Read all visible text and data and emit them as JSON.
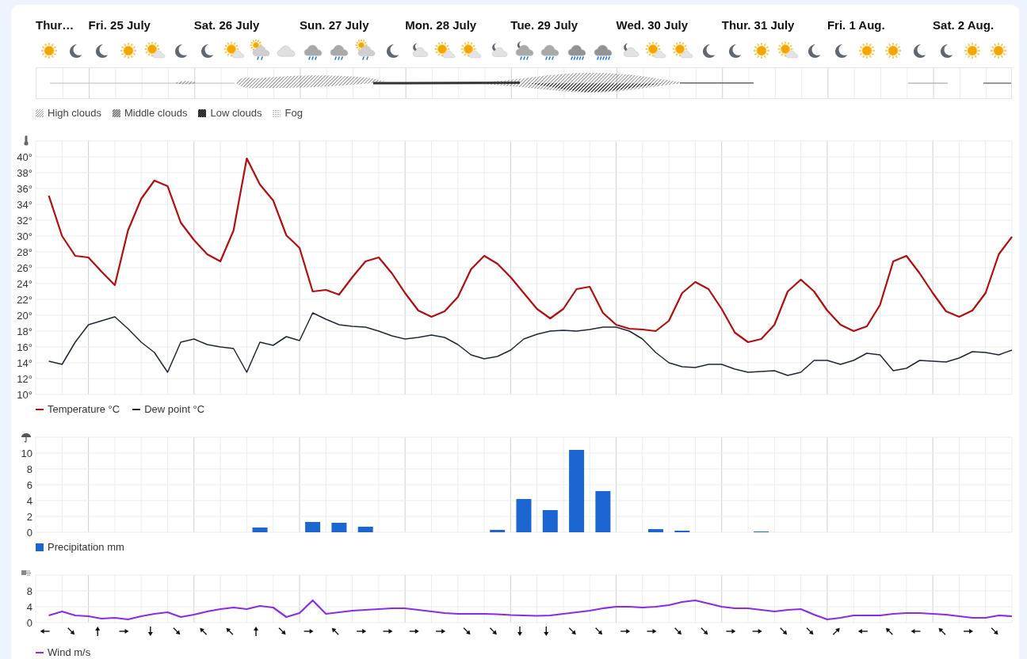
{
  "days": [
    "Thur…",
    "Fri. 25 July",
    "Sat. 26 July",
    "Sun. 27 July",
    "Mon. 28 July",
    "Tue. 29 July",
    "Wed. 30 July",
    "Thur. 31 July",
    "Fri. 1 Aug.",
    "Sat. 2 Aug."
  ],
  "forecast_icons": [
    {
      "kind": "sun"
    },
    {
      "kind": "moon"
    },
    {
      "kind": "moon"
    },
    {
      "kind": "sun"
    },
    {
      "kind": "partly-sunny"
    },
    {
      "kind": "moon"
    },
    {
      "kind": "moon"
    },
    {
      "kind": "partly-sunny"
    },
    {
      "kind": "sun-shower"
    },
    {
      "kind": "cloudy"
    },
    {
      "kind": "rain"
    },
    {
      "kind": "rain"
    },
    {
      "kind": "sun-shower"
    },
    {
      "kind": "moon"
    },
    {
      "kind": "partly-night"
    },
    {
      "kind": "partly-sunny"
    },
    {
      "kind": "partly-sunny"
    },
    {
      "kind": "partly-night"
    },
    {
      "kind": "night-rain"
    },
    {
      "kind": "rain"
    },
    {
      "kind": "heavy-rain"
    },
    {
      "kind": "heavy-rain"
    },
    {
      "kind": "partly-night"
    },
    {
      "kind": "partly-sunny"
    },
    {
      "kind": "partly-sunny"
    },
    {
      "kind": "moon"
    },
    {
      "kind": "moon"
    },
    {
      "kind": "sun"
    },
    {
      "kind": "partly-sunny"
    },
    {
      "kind": "moon"
    },
    {
      "kind": "moon"
    },
    {
      "kind": "sun"
    },
    {
      "kind": "sun"
    },
    {
      "kind": "moon"
    },
    {
      "kind": "moon"
    },
    {
      "kind": "sun"
    },
    {
      "kind": "sun"
    }
  ],
  "cloud_legend": [
    {
      "label": "High clouds",
      "kind": "high"
    },
    {
      "label": "Middle clouds",
      "kind": "middle"
    },
    {
      "label": "Low clouds",
      "kind": "low"
    },
    {
      "label": "Fog",
      "kind": "fog"
    }
  ],
  "temperature": {
    "chart_data": {
      "type": "line",
      "grid": true,
      "categories": [
        null,
        null,
        null,
        null,
        null,
        null,
        null,
        null,
        null,
        null,
        null,
        null,
        null,
        null,
        null,
        null,
        null,
        null,
        null,
        null,
        null,
        null,
        null,
        null,
        null,
        null,
        null,
        null,
        null,
        null,
        null,
        null,
        null,
        null,
        null,
        null,
        null,
        null,
        null,
        null,
        null,
        null,
        null,
        null,
        null,
        null,
        null,
        null,
        null,
        null,
        null,
        null,
        null,
        null,
        null,
        null,
        null,
        null,
        null,
        null,
        null,
        null,
        null,
        null,
        null,
        null,
        null,
        null,
        null,
        null,
        null,
        null,
        null,
        null
      ],
      "ylim": [
        10,
        42
      ],
      "yticks": [
        {
          "value": 10,
          "label": "10°"
        },
        {
          "value": 12,
          "label": "12°"
        },
        {
          "value": 14,
          "label": "14°"
        },
        {
          "value": 16,
          "label": "16°"
        },
        {
          "value": 18,
          "label": "18°"
        },
        {
          "value": 20,
          "label": "20°"
        },
        {
          "value": 22,
          "label": "22°"
        },
        {
          "value": 24,
          "label": "24°"
        },
        {
          "value": 26,
          "label": "26°"
        },
        {
          "value": 28,
          "label": "28°"
        },
        {
          "value": 30,
          "label": "30°"
        },
        {
          "value": 32,
          "label": "32°"
        },
        {
          "value": 34,
          "label": "34°"
        },
        {
          "value": 36,
          "label": "36°"
        },
        {
          "value": 38,
          "label": "38°"
        },
        {
          "value": 40,
          "label": "40°"
        }
      ],
      "series": [
        {
          "name": "Temperature °C",
          "color": "#b40d0d",
          "values": [
            35.1,
            30.0,
            27.5,
            27.3,
            25.5,
            23.8,
            30.7,
            34.7,
            37.0,
            36.3,
            31.7,
            29.5,
            27.7,
            26.8,
            30.7,
            39.8,
            36.5,
            34.5,
            30.1,
            28.5,
            23.0,
            23.2,
            22.6,
            24.8,
            26.8,
            27.3,
            25.3,
            22.8,
            20.6,
            19.8,
            20.5,
            22.3,
            25.8,
            27.5,
            26.5,
            24.8,
            22.8,
            20.8,
            19.6,
            20.8,
            23.3,
            23.6,
            20.3,
            18.8,
            18.3,
            18.2,
            18.0,
            19.3,
            22.8,
            24.2,
            23.3,
            20.8,
            17.8,
            16.6,
            17.0,
            18.8,
            23.0,
            24.5,
            23.0,
            20.6,
            18.8,
            18.0,
            18.6,
            21.3,
            26.8,
            27.5,
            25.3,
            22.8,
            20.5,
            19.8,
            20.6,
            22.8,
            27.7,
            29.9
          ]
        },
        {
          "name": "Dew point °C",
          "color": "#1e2833",
          "values": [
            14.2,
            13.8,
            16.6,
            18.8,
            19.3,
            19.8,
            18.3,
            16.6,
            15.3,
            12.8,
            16.6,
            17.0,
            16.3,
            16.0,
            15.8,
            12.8,
            16.6,
            16.2,
            17.3,
            16.8,
            20.3,
            19.5,
            18.8,
            18.6,
            18.5,
            18.0,
            17.4,
            17.0,
            17.2,
            17.5,
            17.2,
            16.3,
            15.0,
            14.5,
            14.8,
            15.6,
            17.0,
            17.6,
            18.0,
            18.1,
            18.0,
            18.2,
            18.5,
            18.5,
            18.0,
            17.0,
            15.3,
            14.0,
            13.5,
            13.4,
            13.8,
            13.8,
            13.2,
            12.8,
            12.9,
            13.0,
            12.4,
            12.8,
            14.3,
            14.3,
            13.8,
            14.3,
            15.2,
            15.0,
            13.0,
            13.3,
            14.3,
            14.2,
            14.1,
            14.6,
            15.4,
            15.3,
            15.0,
            15.6
          ]
        }
      ]
    }
  },
  "precipitation": {
    "chart_data": {
      "type": "bar",
      "grid": true,
      "categories": [
        null,
        null,
        null,
        null,
        null,
        null,
        null,
        null,
        null,
        null,
        null,
        null,
        null,
        null,
        null,
        null,
        null,
        null,
        null,
        null,
        null,
        null,
        null,
        null,
        null,
        null,
        null,
        null,
        null,
        null,
        null,
        null,
        null,
        null,
        null,
        null,
        null
      ],
      "ylim": [
        0,
        12
      ],
      "yticks": [
        {
          "value": 0,
          "label": "0"
        },
        {
          "value": 2,
          "label": "2"
        },
        {
          "value": 4,
          "label": "4"
        },
        {
          "value": 6,
          "label": "6"
        },
        {
          "value": 8,
          "label": "8"
        },
        {
          "value": 10,
          "label": "10"
        }
      ],
      "series": [
        {
          "name": "Precipitation mm",
          "color": "#1b66d0",
          "values": [
            0,
            0,
            0,
            0,
            0,
            0,
            0,
            0,
            0.6,
            0,
            1.3,
            1.2,
            0.7,
            0,
            0,
            0,
            0,
            0.3,
            4.2,
            2.8,
            10.4,
            5.2,
            0,
            0.4,
            0.2,
            0,
            0,
            0.1,
            0,
            0,
            0,
            0,
            0,
            0,
            0,
            0,
            0
          ]
        }
      ]
    }
  },
  "wind": {
    "chart_data": {
      "type": "line",
      "grid": true,
      "categories": [
        null,
        null,
        null,
        null,
        null,
        null,
        null,
        null,
        null,
        null,
        null,
        null,
        null,
        null,
        null,
        null,
        null,
        null,
        null,
        null,
        null,
        null,
        null,
        null,
        null,
        null,
        null,
        null,
        null,
        null,
        null,
        null,
        null,
        null,
        null,
        null,
        null,
        null,
        null,
        null,
        null,
        null,
        null,
        null,
        null,
        null,
        null,
        null,
        null,
        null,
        null,
        null,
        null,
        null,
        null,
        null,
        null,
        null,
        null,
        null,
        null,
        null,
        null,
        null,
        null,
        null,
        null,
        null,
        null,
        null,
        null,
        null,
        null,
        null
      ],
      "ylim": [
        0,
        12
      ],
      "yticks": [
        {
          "value": 0,
          "label": "0"
        },
        {
          "value": 4,
          "label": "4"
        },
        {
          "value": 8,
          "label": "8"
        }
      ],
      "series": [
        {
          "name": "Wind m/s",
          "color": "#8a2be8",
          "values": [
            1.8,
            2.8,
            1.8,
            1.6,
            1.0,
            1.2,
            0.8,
            1.6,
            2.2,
            2.6,
            1.4,
            2.0,
            2.8,
            3.4,
            3.8,
            3.4,
            4.2,
            3.8,
            1.4,
            2.4,
            5.6,
            2.2,
            2.6,
            3.0,
            3.2,
            3.4,
            3.6,
            3.6,
            3.2,
            2.8,
            2.4,
            2.2,
            2.2,
            2.2,
            2.1,
            1.9,
            1.8,
            1.7,
            1.8,
            2.2,
            2.6,
            3.0,
            3.6,
            4.0,
            4.0,
            3.8,
            4.0,
            4.4,
            5.2,
            5.6,
            4.8,
            4.0,
            3.6,
            3.6,
            3.2,
            2.8,
            3.2,
            3.4,
            2.0,
            0.8,
            1.2,
            1.8,
            1.8,
            1.8,
            2.2,
            2.4,
            2.4,
            2.2,
            2.0,
            1.6,
            1.2,
            1.2,
            1.8,
            1.6
          ]
        }
      ]
    },
    "arrows": [
      {
        "kind": "w"
      },
      {
        "kind": "se"
      },
      {
        "kind": "n"
      },
      {
        "kind": "e"
      },
      {
        "kind": "s"
      },
      {
        "kind": "se"
      },
      {
        "kind": "nw"
      },
      {
        "kind": "nw"
      },
      {
        "kind": "n"
      },
      {
        "kind": "se"
      },
      {
        "kind": "e"
      },
      {
        "kind": "nw"
      },
      {
        "kind": "e"
      },
      {
        "kind": "e"
      },
      {
        "kind": "e"
      },
      {
        "kind": "e"
      },
      {
        "kind": "se"
      },
      {
        "kind": "se"
      },
      {
        "kind": "s"
      },
      {
        "kind": "s"
      },
      {
        "kind": "se"
      },
      {
        "kind": "se"
      },
      {
        "kind": "e"
      },
      {
        "kind": "e"
      },
      {
        "kind": "se"
      },
      {
        "kind": "se"
      },
      {
        "kind": "e"
      },
      {
        "kind": "e"
      },
      {
        "kind": "se"
      },
      {
        "kind": "se"
      },
      {
        "kind": "ne"
      },
      {
        "kind": "w"
      },
      {
        "kind": "nw"
      },
      {
        "kind": "w"
      },
      {
        "kind": "nw"
      },
      {
        "kind": "e"
      },
      {
        "kind": "se"
      }
    ]
  }
}
